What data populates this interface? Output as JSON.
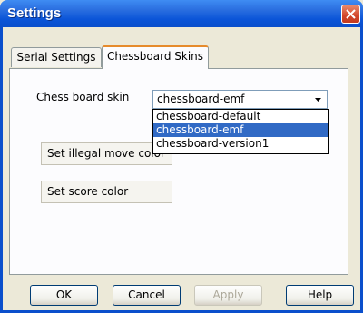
{
  "window": {
    "title": "Settings",
    "close_icon": "close-icon"
  },
  "tabs": [
    {
      "label": "Serial Settings",
      "active": false
    },
    {
      "label": "Chessboard Skins",
      "active": true
    }
  ],
  "skin": {
    "label": "Chess board skin",
    "selected": "chessboard-emf",
    "options": [
      "chessboard-default",
      "chessboard-emf",
      "chessboard-version1"
    ],
    "highlighted": "chessboard-emf"
  },
  "buttons": {
    "illegal": "Set illegal move color",
    "score": "Set score color",
    "ok": "OK",
    "cancel": "Cancel",
    "apply": "Apply",
    "help": "Help"
  },
  "colors": {
    "title_bar": "#0a4fcc",
    "selection": "#316ac5",
    "close": "#d2452a"
  }
}
